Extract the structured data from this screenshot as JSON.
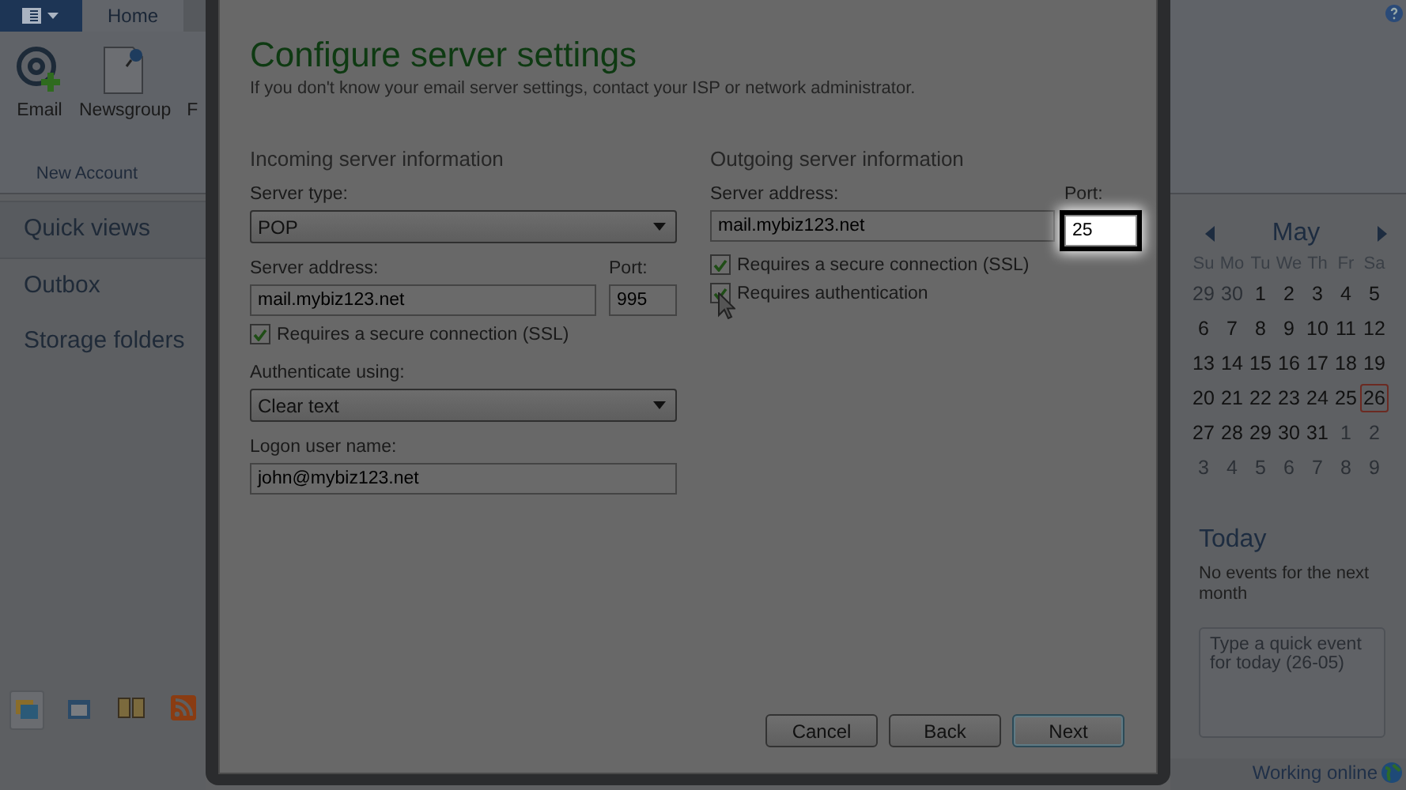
{
  "ribbon": {
    "tabs": [
      {
        "label": "Home",
        "selected": true
      }
    ],
    "buttons": [
      {
        "label": "Email",
        "kind": "email"
      },
      {
        "label": "Newsgroup",
        "kind": "newsgroup"
      },
      {
        "label": "F",
        "kind": "partial"
      }
    ],
    "group_label": "New Account"
  },
  "sidebar": {
    "items": [
      {
        "label": "Quick views",
        "selected": true
      },
      {
        "label": "Outbox",
        "selected": false
      },
      {
        "label": "Storage folders",
        "selected": false
      }
    ]
  },
  "dialog": {
    "title": "Configure server settings",
    "subtitle": "If you don't know your email server settings, contact your ISP or network administrator.",
    "incoming": {
      "heading": "Incoming server information",
      "server_type": {
        "label": "Server type:",
        "value": "POP"
      },
      "server_address": {
        "label": "Server address:",
        "value": "mail.mybiz123.net"
      },
      "port": {
        "label": "Port:",
        "value": "995",
        "highlighted": false
      },
      "ssl": {
        "label": "Requires a secure connection (SSL)",
        "checked": true
      },
      "authenticate": {
        "label": "Authenticate using:",
        "value": "Clear text"
      },
      "user_name": {
        "label": "Logon user name:",
        "value": "john@mybiz123.net"
      }
    },
    "outgoing": {
      "heading": "Outgoing server information",
      "server_address": {
        "label": "Server address:",
        "value": "mail.mybiz123.net"
      },
      "port": {
        "label": "Port:",
        "value": "25",
        "highlighted": true
      },
      "checkboxes": [
        {
          "label": "Requires a secure connection (SSL)",
          "checked": true
        },
        {
          "label": "Requires authentication",
          "checked": true
        }
      ]
    },
    "buttons": [
      {
        "label": "Cancel",
        "default": false
      },
      {
        "label": "Back",
        "default": false
      },
      {
        "label": "Next",
        "default": true
      }
    ]
  },
  "calendar": {
    "month": "May",
    "weekdays": [
      "Su",
      "Mo",
      "Tu",
      "We",
      "Th",
      "Fr",
      "Sa"
    ],
    "weeks": [
      [
        {
          "day": "29",
          "outside": true,
          "today": false
        },
        {
          "day": "30",
          "outside": true,
          "today": false
        },
        {
          "day": "1",
          "outside": false,
          "today": false
        },
        {
          "day": "2",
          "outside": false,
          "today": false
        },
        {
          "day": "3",
          "outside": false,
          "today": false
        },
        {
          "day": "4",
          "outside": false,
          "today": false
        },
        {
          "day": "5",
          "outside": false,
          "today": false
        }
      ],
      [
        {
          "day": "6",
          "outside": false,
          "today": false
        },
        {
          "day": "7",
          "outside": false,
          "today": false
        },
        {
          "day": "8",
          "outside": false,
          "today": false
        },
        {
          "day": "9",
          "outside": false,
          "today": false
        },
        {
          "day": "10",
          "outside": false,
          "today": false
        },
        {
          "day": "11",
          "outside": false,
          "today": false
        },
        {
          "day": "12",
          "outside": false,
          "today": false
        }
      ],
      [
        {
          "day": "13",
          "outside": false,
          "today": false
        },
        {
          "day": "14",
          "outside": false,
          "today": false
        },
        {
          "day": "15",
          "outside": false,
          "today": false
        },
        {
          "day": "16",
          "outside": false,
          "today": false
        },
        {
          "day": "17",
          "outside": false,
          "today": false
        },
        {
          "day": "18",
          "outside": false,
          "today": false
        },
        {
          "day": "19",
          "outside": false,
          "today": false
        }
      ],
      [
        {
          "day": "20",
          "outside": false,
          "today": false
        },
        {
          "day": "21",
          "outside": false,
          "today": false
        },
        {
          "day": "22",
          "outside": false,
          "today": false
        },
        {
          "day": "23",
          "outside": false,
          "today": false
        },
        {
          "day": "24",
          "outside": false,
          "today": false
        },
        {
          "day": "25",
          "outside": false,
          "today": false
        },
        {
          "day": "26",
          "outside": false,
          "today": true
        }
      ],
      [
        {
          "day": "27",
          "outside": false,
          "today": false
        },
        {
          "day": "28",
          "outside": false,
          "today": false
        },
        {
          "day": "29",
          "outside": false,
          "today": false
        },
        {
          "day": "30",
          "outside": false,
          "today": false
        },
        {
          "day": "31",
          "outside": false,
          "today": false
        },
        {
          "day": "1",
          "outside": true,
          "today": false
        },
        {
          "day": "2",
          "outside": true,
          "today": false
        }
      ],
      [
        {
          "day": "3",
          "outside": true,
          "today": false
        },
        {
          "day": "4",
          "outside": true,
          "today": false
        },
        {
          "day": "5",
          "outside": true,
          "today": false
        },
        {
          "day": "6",
          "outside": true,
          "today": false
        },
        {
          "day": "7",
          "outside": true,
          "today": false
        },
        {
          "day": "8",
          "outside": true,
          "today": false
        },
        {
          "day": "9",
          "outside": true,
          "today": false
        }
      ]
    ]
  },
  "today": {
    "title": "Today",
    "message": "No events for the next month",
    "quick_event": {
      "placeholder": "Type a quick event for today (26-05)"
    }
  },
  "status_bar": {
    "text": "Working online"
  }
}
